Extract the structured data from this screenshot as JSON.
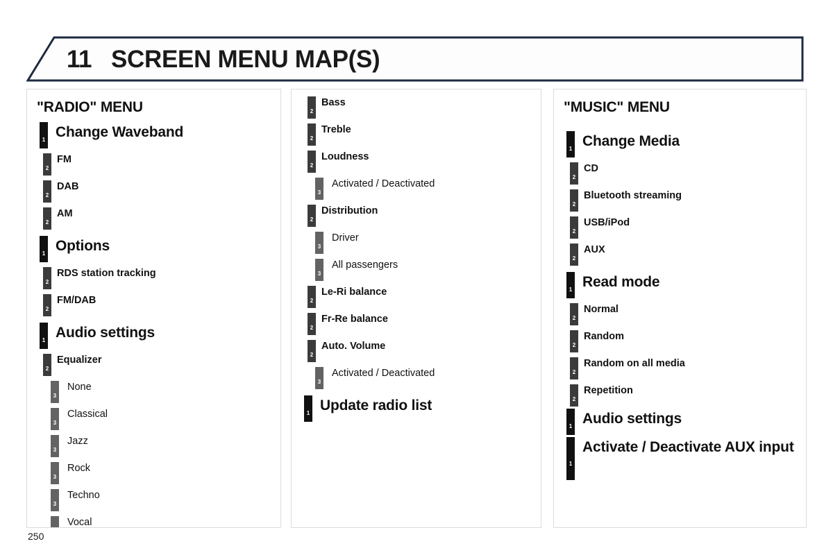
{
  "header": {
    "chapter_number": "11",
    "title": "SCREEN MENU MAP(S)",
    "border_color": "#1d2b40",
    "fill_color": "#fdfdfd"
  },
  "colors": {
    "level1": "#111111",
    "level2": "#3b3b3b",
    "level3": "#636363",
    "panel_border": "#dcdcdc",
    "text": "#111111"
  },
  "page_number": "250",
  "columns": [
    {
      "id": "radio-menu",
      "title": "\"RADIO\" MENU",
      "items": [
        {
          "level": 1,
          "label": "Change Waveband"
        },
        {
          "level": 2,
          "label": "FM"
        },
        {
          "level": 2,
          "label": "DAB"
        },
        {
          "level": 2,
          "label": "AM"
        },
        {
          "level": 1,
          "label": "Options"
        },
        {
          "level": 2,
          "label": "RDS station tracking"
        },
        {
          "level": 2,
          "label": "FM/DAB"
        },
        {
          "level": 1,
          "label": "Audio settings"
        },
        {
          "level": 2,
          "label": "Equalizer"
        },
        {
          "level": 3,
          "label": "None"
        },
        {
          "level": 3,
          "label": "Classical"
        },
        {
          "level": 3,
          "label": "Jazz"
        },
        {
          "level": 3,
          "label": "Rock"
        },
        {
          "level": 3,
          "label": "Techno"
        },
        {
          "level": 3,
          "label": "Vocal"
        }
      ]
    },
    {
      "id": "radio-menu-continued",
      "title": "",
      "items": [
        {
          "level": 2,
          "label": "Bass"
        },
        {
          "level": 2,
          "label": "Treble"
        },
        {
          "level": 2,
          "label": "Loudness"
        },
        {
          "level": 3,
          "label": "Activated / Deactivated"
        },
        {
          "level": 2,
          "label": "Distribution"
        },
        {
          "level": 3,
          "label": "Driver"
        },
        {
          "level": 3,
          "label": "All passengers"
        },
        {
          "level": 2,
          "label": "Le-Ri balance"
        },
        {
          "level": 2,
          "label": "Fr-Re balance"
        },
        {
          "level": 2,
          "label": "Auto. Volume"
        },
        {
          "level": 3,
          "label": "Activated / Deactivated"
        },
        {
          "level": 1,
          "label": "Update radio list"
        }
      ]
    },
    {
      "id": "music-menu",
      "title": "\"MUSIC\" MENU",
      "items": [
        {
          "level": 1,
          "label": "Change Media",
          "gap_before": true
        },
        {
          "level": 2,
          "label": "CD"
        },
        {
          "level": 2,
          "label": "Bluetooth streaming"
        },
        {
          "level": 2,
          "label": "USB/iPod"
        },
        {
          "level": 2,
          "label": "AUX"
        },
        {
          "level": 1,
          "label": "Read mode"
        },
        {
          "level": 2,
          "label": "Normal"
        },
        {
          "level": 2,
          "label": "Random"
        },
        {
          "level": 2,
          "label": "Random on all media"
        },
        {
          "level": 2,
          "label": "Repetition"
        },
        {
          "level": 1,
          "label": "Audio settings",
          "tight": true
        },
        {
          "level": 1,
          "label": "Activate / Deactivate AUX input",
          "tight": true
        }
      ]
    }
  ]
}
